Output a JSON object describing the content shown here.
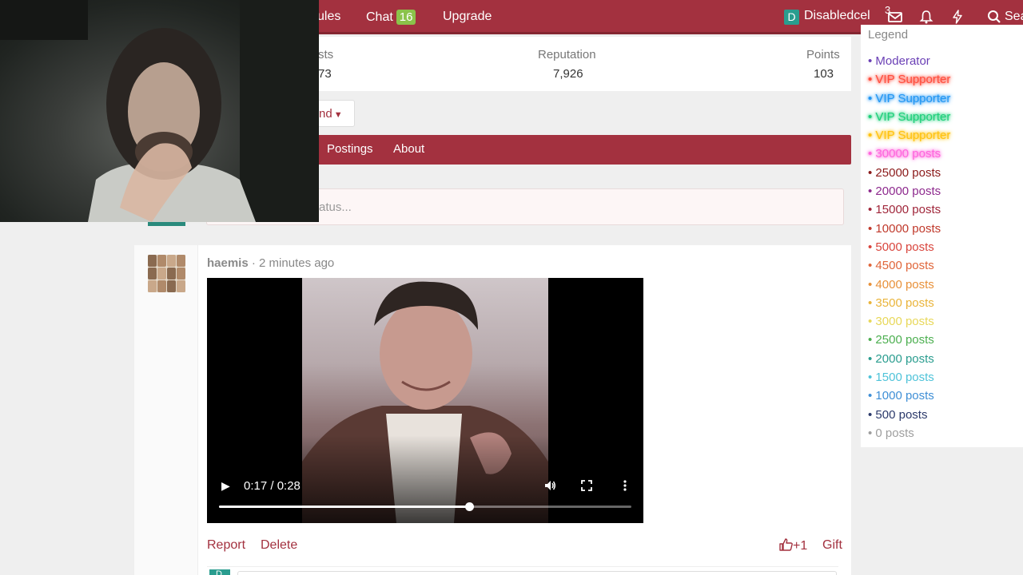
{
  "topnav": {
    "items": [
      {
        "label": "ules"
      },
      {
        "label": "Chat",
        "badge": "16"
      },
      {
        "label": "Upgrade"
      }
    ],
    "user": {
      "initial": "D",
      "name": "Disabledcel"
    },
    "inbox_count": "3",
    "search_label": "Sea",
    "colors": {
      "bar": "#a3313f",
      "badge": "#8bc34a"
    }
  },
  "profile": {
    "stats": [
      {
        "label": "sts",
        "value": "73"
      },
      {
        "label": "Reputation",
        "value": "7,926"
      },
      {
        "label": "Points",
        "value": "103"
      }
    ],
    "find_button": "nd",
    "tabs": [
      "Postings",
      "About"
    ],
    "status_placeholder": "atus..."
  },
  "post": {
    "username": "haemis",
    "time": "2 minutes ago",
    "video": {
      "time_display": "0:17 / 0:28",
      "progress": 0.607
    },
    "actions": {
      "report": "Report",
      "delete": "Delete",
      "like": "+1",
      "gift": "Gift"
    },
    "reply_avatar_initial": "D"
  },
  "legend": {
    "title": "Legend",
    "items": [
      {
        "label": "Moderator",
        "color": "#6a3fb5",
        "glow": false
      },
      {
        "label": "VIP Supporter",
        "color": "#ff4d3d",
        "glow": true
      },
      {
        "label": "VIP Supporter",
        "color": "#2196f3",
        "glow": true
      },
      {
        "label": "VIP Supporter",
        "color": "#1ecf7a",
        "glow": true
      },
      {
        "label": "VIP Supporter",
        "color": "#ffc20e",
        "glow": true
      },
      {
        "label": "30000 posts",
        "color": "#ff66dd",
        "glow": true
      },
      {
        "label": "25000 posts",
        "color": "#8b1a1a",
        "glow": false
      },
      {
        "label": "20000 posts",
        "color": "#8e2a8e",
        "glow": false
      },
      {
        "label": "15000 posts",
        "color": "#a0263a",
        "glow": false
      },
      {
        "label": "10000 posts",
        "color": "#c0392b",
        "glow": false
      },
      {
        "label": "5000 posts",
        "color": "#d9453d",
        "glow": false
      },
      {
        "label": "4500 posts",
        "color": "#e0663a",
        "glow": false
      },
      {
        "label": "4000 posts",
        "color": "#e8913a",
        "glow": false
      },
      {
        "label": "3500 posts",
        "color": "#eab43a",
        "glow": false
      },
      {
        "label": "3000 posts",
        "color": "#e8d85a",
        "glow": false
      },
      {
        "label": "2500 posts",
        "color": "#4caf50",
        "glow": false
      },
      {
        "label": "2000 posts",
        "color": "#2a9d8f",
        "glow": false
      },
      {
        "label": "1500 posts",
        "color": "#4fc3d9",
        "glow": false
      },
      {
        "label": "1000 posts",
        "color": "#3f8fd6",
        "glow": false
      },
      {
        "label": "500 posts",
        "color": "#2c3a6b",
        "glow": false
      },
      {
        "label": "0 posts",
        "color": "#9e9e9e",
        "glow": false
      }
    ]
  }
}
